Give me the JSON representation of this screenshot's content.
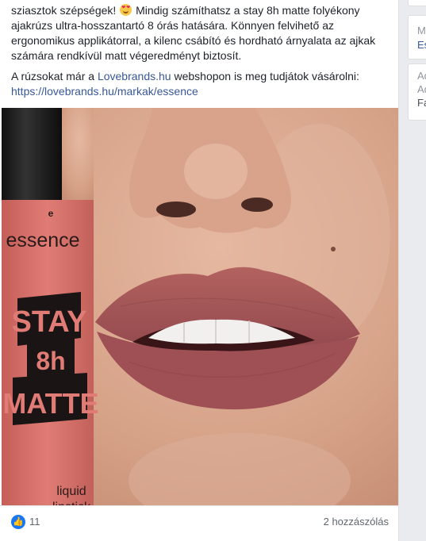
{
  "post": {
    "paragraph1_part1": "sziasztok szépségek!",
    "emoji_icon": "heart-eyes-emoji",
    "paragraph1_part2": "Mindig számíthatsz a stay 8h matte folyékony ajakrúzs ultra-hosszantartó 8 órás hatására. Könnyen felvihető az ergonomikus applikátorral, a kilenc csábító és hordható árnyalata az ajkak számára rendkívül matt végeredményt biztosít.",
    "paragraph2_part1": "A rúzsokat már a",
    "paragraph2_link": "Lovebrands.hu",
    "paragraph2_part2": "webshopon is meg tudjátok vásárolni:",
    "url": "https://lovebrands.hu/markak/essence"
  },
  "photo": {
    "brand_logo": "essence",
    "product_line1": "STAY",
    "product_line2": "8h",
    "product_line3": "MATTE",
    "product_type_line1": "liquid",
    "product_type_line2": "lipstick",
    "colors": {
      "tube": "#d9706a",
      "lips": "#a4575a",
      "skin": "#d9a890"
    }
  },
  "footer": {
    "like_icon": "thumbs-up-icon",
    "likes": "11",
    "comments": "2 hozzászólás"
  },
  "sidebar": {
    "card2_line1": "M",
    "card2_line2": "Es",
    "card3_line1": "Ad",
    "card3_line2": "Ad",
    "card3_line3": "Fa"
  }
}
